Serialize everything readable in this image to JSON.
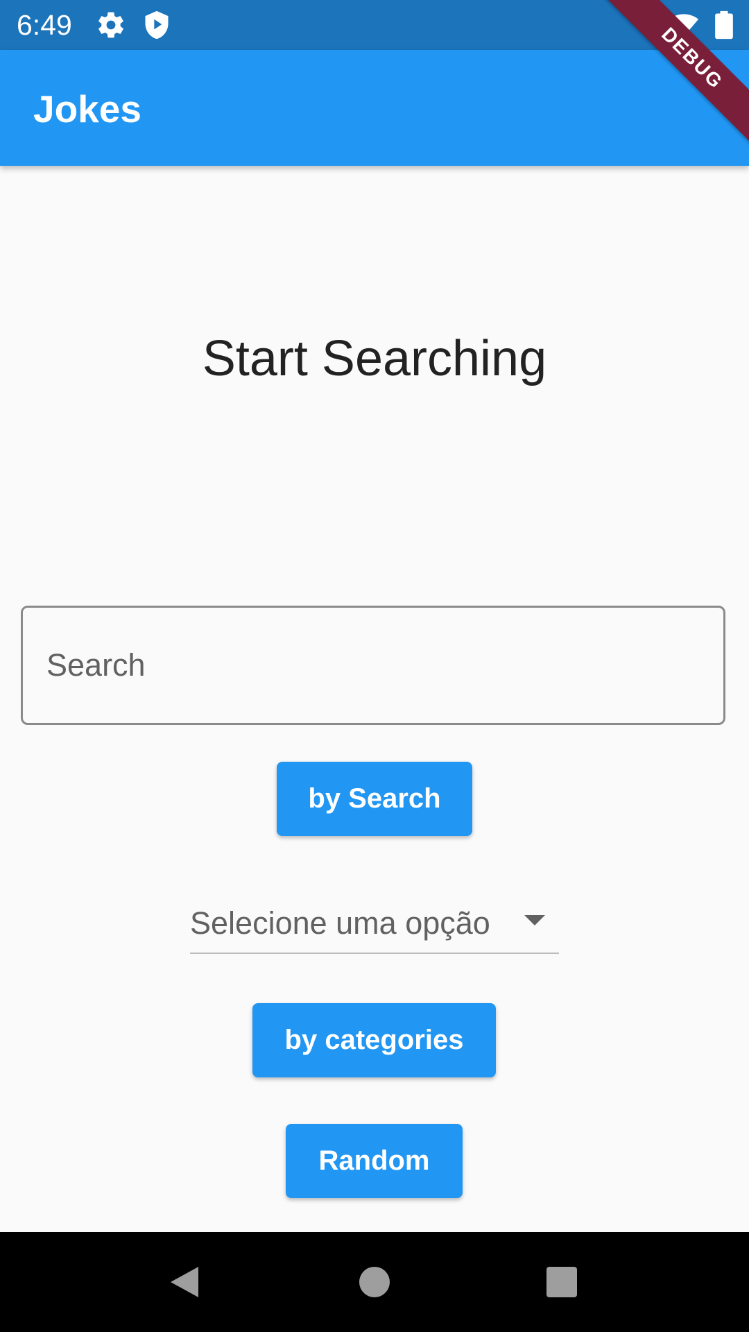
{
  "status_bar": {
    "time": "6:49",
    "icons": [
      "gear-icon",
      "shield-play-icon",
      "wifi-icon",
      "battery-icon"
    ],
    "color": "#1c74bb"
  },
  "app_bar": {
    "title": "Jokes",
    "color": "#2196f3"
  },
  "debug_banner": "DEBUG",
  "main": {
    "headline": "Start Searching",
    "search": {
      "placeholder": "Search",
      "value": ""
    },
    "search_button": "by Search",
    "dropdown": {
      "selected": "Selecione uma opção",
      "icon": "caret-down-icon"
    },
    "categories_button": "by categories",
    "random_button": "Random"
  },
  "nav_bar": {
    "buttons": [
      "back-icon",
      "home-icon",
      "recents-icon"
    ]
  }
}
